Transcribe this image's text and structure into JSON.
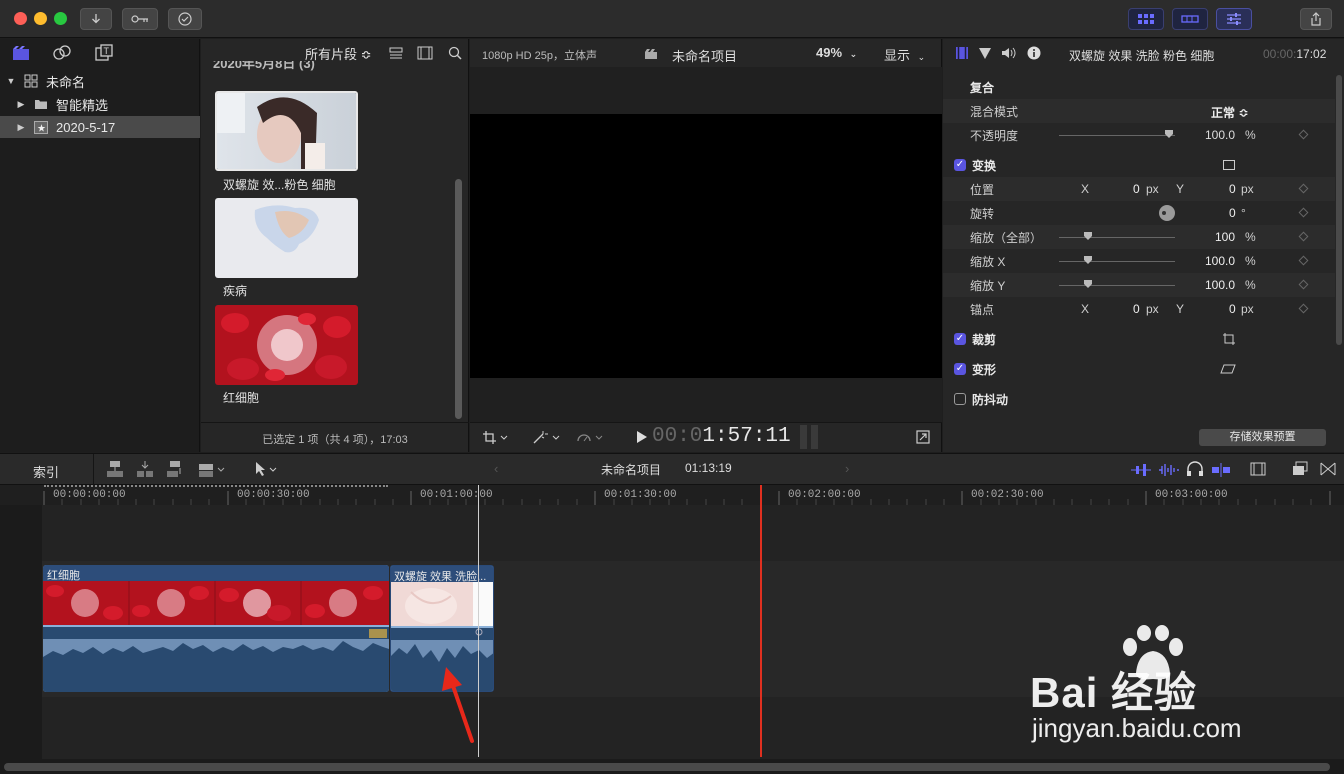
{
  "toolbar": {
    "import_icon": "down-arrow",
    "keyword_icon": "key",
    "check_icon": "checkmark",
    "share_icon": "share"
  },
  "library": {
    "root": "未命名",
    "items": [
      {
        "label": "智能精选"
      },
      {
        "label": "2020-5-17"
      }
    ]
  },
  "browser": {
    "filter": "所有片段 ≎",
    "date_group": "2020年5月8日 (3)",
    "clips": [
      {
        "label": "双螺旋 效...粉色 细胞"
      },
      {
        "label": "疾病"
      },
      {
        "label": "红细胞"
      }
    ],
    "status": "已选定 1 项（共 4 项），17:03"
  },
  "viewer": {
    "format": "1080p HD 25p，立体声",
    "project": "未命名项目",
    "zoom": "49%",
    "display_menu": "显示",
    "timecode_dim": "00:0",
    "timecode_bright": "1:57:11"
  },
  "inspector": {
    "clip_name": "双螺旋 效果 洗脸 粉色 细胞",
    "duration_dim": "00:00:",
    "duration": "17:02",
    "composite": "复合",
    "blend_mode_label": "混合模式",
    "blend_mode_value": "正常 ≎",
    "opacity_label": "不透明度",
    "opacity_value": "100.0",
    "transform": "变换",
    "position": "位置",
    "pos_x": "0",
    "pos_y": "0",
    "rotation": "旋转",
    "rotation_value": "0",
    "scale_all": "缩放（全部）",
    "scale_all_value": "100",
    "scale_x": "缩放 X",
    "scale_x_value": "100.0",
    "scale_y": "缩放 Y",
    "scale_y_value": "100.0",
    "anchor": "锚点",
    "anchor_x": "0",
    "anchor_y": "0",
    "crop": "裁剪",
    "distort": "变形",
    "stabilize": "防抖动",
    "save_preset": "存储效果预置",
    "unit_px": "px",
    "unit_pct": "%",
    "unit_deg": "°",
    "x": "X",
    "y": "Y"
  },
  "timeline": {
    "index": "索引",
    "project": "未命名项目",
    "duration": "01:13:19",
    "ruler": [
      "00:00:00:00",
      "00:00:30:00",
      "00:01:00:00",
      "00:01:30:00",
      "00:02:00:00",
      "00:02:30:00",
      "00:03:00:00"
    ],
    "clips": [
      {
        "label": "红细胞"
      },
      {
        "label": "双螺旋 效果 洗脸..."
      }
    ]
  },
  "watermark": {
    "brand": "Bai 经验",
    "url": "jingyan.baidu.com"
  },
  "colors": {
    "accent": "#5a55e0",
    "playhead": "#e03020",
    "clip_blue": "#2d4d7a",
    "audio_wave": "#6f8fb5"
  }
}
